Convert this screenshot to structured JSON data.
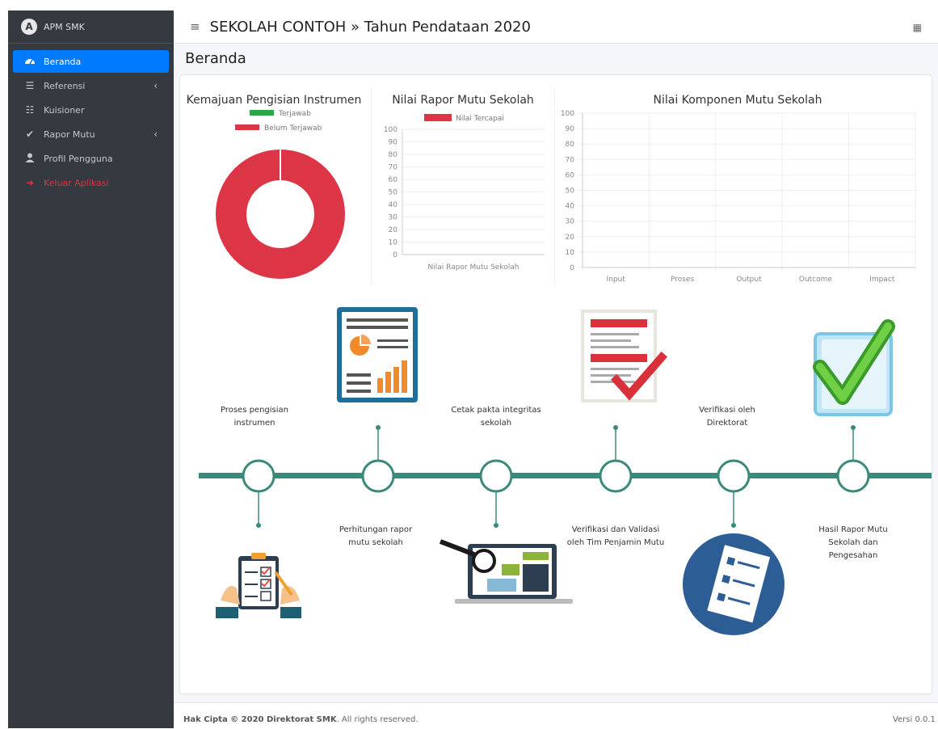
{
  "app": {
    "brand": "APM SMK"
  },
  "sidebar": {
    "items": [
      {
        "label": "Beranda",
        "icon": "dashboard-icon",
        "active": true
      },
      {
        "label": "Referensi",
        "icon": "list-icon",
        "has_children": true
      },
      {
        "label": "Kuisioner",
        "icon": "checklist-icon"
      },
      {
        "label": "Rapor Mutu",
        "icon": "check-icon",
        "has_children": true
      },
      {
        "label": "Profil Pengguna",
        "icon": "user-icon"
      },
      {
        "label": "Keluar Aplikasi",
        "icon": "logout-icon",
        "color": "#dc3545"
      }
    ]
  },
  "header": {
    "title": "SEKOLAH CONTOH » Tahun Pendataan 2020"
  },
  "page": {
    "title": "Beranda"
  },
  "charts": {
    "doughnut_title": "Kemajuan Pengisian Instrumen",
    "rapor_title": "Nilai Rapor Mutu Sekolah",
    "komponen_title": "Nilai Komponen Mutu Sekolah"
  },
  "chart_data": [
    {
      "type": "pie",
      "title": "Kemajuan Pengisian Instrumen",
      "categories": [
        "Terjawab",
        "Belum Terjawab"
      ],
      "values": [
        0,
        100
      ],
      "colors": [
        "#28a745",
        "#dc3545"
      ],
      "legend": "top"
    },
    {
      "type": "bar",
      "title": "Nilai Rapor Mutu Sekolah",
      "categories": [
        "Nilai Rapor Mutu Sekolah"
      ],
      "series": [
        {
          "name": "Nilai Tercapai",
          "values": [
            0
          ]
        }
      ],
      "ylim": [
        0,
        100
      ],
      "yticks": [
        0,
        10,
        20,
        30,
        40,
        50,
        60,
        70,
        80,
        90,
        100
      ],
      "colors": [
        "#dc3545"
      ],
      "legend": "top"
    },
    {
      "type": "bar",
      "title": "Nilai Komponen Mutu Sekolah",
      "categories": [
        "Input",
        "Proses",
        "Output",
        "Outcome",
        "Impact"
      ],
      "values": [
        0,
        0,
        0,
        0,
        0
      ],
      "ylim": [
        0,
        100
      ],
      "yticks": [
        0,
        10,
        20,
        30,
        40,
        50,
        60,
        70,
        80,
        90,
        100
      ],
      "grid": true
    }
  ],
  "timeline": {
    "steps": [
      {
        "label": "Proses pengisian instrumen",
        "icon": "clipboard-checklist-icon"
      },
      {
        "label": "Perhitungan rapor mutu sekolah",
        "icon": "report-chart-icon"
      },
      {
        "label": "Cetak pakta integritas sekolah",
        "icon": "laptop-magnifier-icon"
      },
      {
        "label": "Verifikasi dan Validasi oleh Tim Penjamin Mutu",
        "icon": "document-checkmark-icon"
      },
      {
        "label": "Verifikasi oleh Direktorat",
        "icon": "checklist-circle-icon"
      },
      {
        "label": "Hasil Rapor Mutu Sekolah dan Pengesahan",
        "icon": "checkbox-icon"
      }
    ],
    "line_color": "#3a8a7c"
  },
  "footer": {
    "copyright_bold": "Hak Cipta © 2020 Direktorat SMK",
    "copyright_rest": ". All rights reserved.",
    "version": "Versi 0.0.1 ("
  }
}
